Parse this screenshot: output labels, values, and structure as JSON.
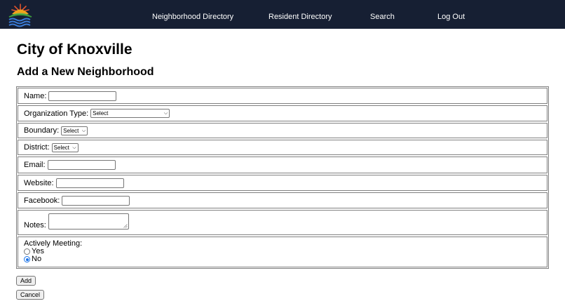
{
  "header": {
    "logo_icon": "city-sunrise-logo",
    "nav": [
      {
        "label": "Neighborhood Directory"
      },
      {
        "label": "Resident Directory"
      },
      {
        "label": "Search"
      },
      {
        "label": "Log Out"
      }
    ]
  },
  "page": {
    "title": "City of Knoxville",
    "subtitle": "Add a New Neighborhood"
  },
  "form": {
    "name_label": "Name:",
    "name_value": "",
    "org_type_label": "Organization Type:",
    "org_type_selected": "Select",
    "boundary_label": "Boundary:",
    "boundary_selected": "Select",
    "district_label": "District:",
    "district_selected": "Select",
    "email_label": "Email:",
    "email_value": "",
    "website_label": "Website:",
    "website_value": "",
    "facebook_label": "Facebook:",
    "facebook_value": "",
    "notes_label": "Notes:",
    "notes_value": "",
    "meeting_label": "Actively Meeting:",
    "meeting_options": [
      {
        "label": "Yes",
        "checked": false
      },
      {
        "label": "No",
        "checked": true
      }
    ]
  },
  "buttons": {
    "add_label": "Add",
    "cancel_label": "Cancel"
  },
  "colors": {
    "header_bg": "#161f33",
    "radio_accent": "#1a73e8"
  }
}
